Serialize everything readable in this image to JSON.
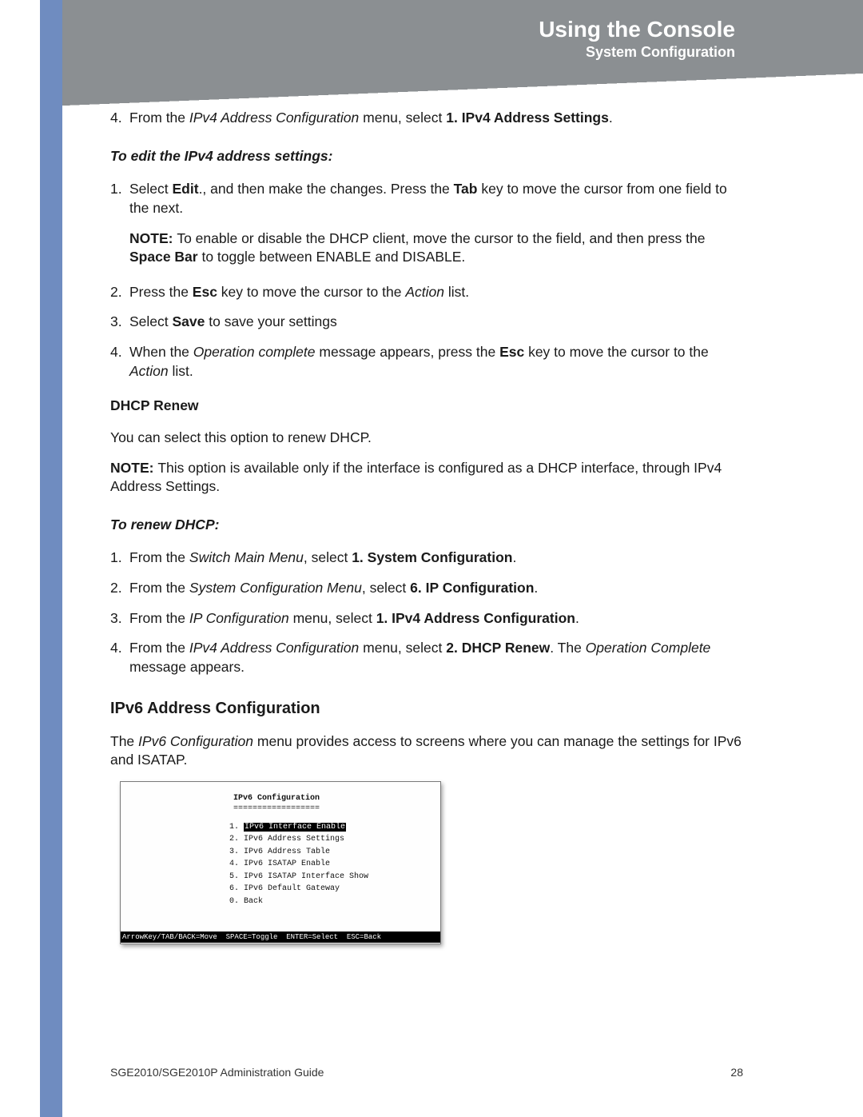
{
  "header": {
    "title": "Using the Console",
    "subtitle": "System Configuration"
  },
  "step4_top": {
    "num": "4.",
    "pre": "From the ",
    "ital": "IPv4 Address Configuration",
    "mid": " menu, select ",
    "bold": "1. IPv4 Address Settings",
    "post": "."
  },
  "edit_ipv4_heading": "To edit the IPv4 address settings:",
  "edit_steps": {
    "s1": {
      "num": "1.",
      "a": "Select ",
      "b": "Edit",
      "c": "., and then make the changes. Press the ",
      "d": "Tab",
      "e": " key to move the cursor from one field to the next."
    },
    "note1": {
      "label": "NOTE: ",
      "a": "To enable or disable the DHCP client, move the cursor to the field, and then press the ",
      "b": "Space Bar",
      "c": " to toggle between ENABLE and DISABLE."
    },
    "s2": {
      "num": "2.",
      "a": "Press the ",
      "b": "Esc",
      "c": " key to move the cursor to the ",
      "d": "Action",
      "e": " list."
    },
    "s3": {
      "num": "3.",
      "a": "Select ",
      "b": "Save",
      "c": " to save your settings"
    },
    "s4": {
      "num": "4.",
      "a": "When the ",
      "b": "Operation complete",
      "c": " message appears, press the ",
      "d": "Esc",
      "e": " key to move the cursor to the ",
      "f": "Action",
      "g": " list."
    }
  },
  "dhcp_renew_heading": "DHCP Renew",
  "dhcp_renew_intro": "You can select this option to renew DHCP.",
  "dhcp_note": {
    "label": "NOTE: ",
    "text": "This option is available only if the interface is configured as a DHCP interface, through IPv4 Address Settings."
  },
  "renew_heading": "To renew DHCP:",
  "renew_steps": {
    "s1": {
      "num": "1.",
      "a": "From the ",
      "b": "Switch Main Menu",
      "c": ", select ",
      "d": "1. System Configuration",
      "e": "."
    },
    "s2": {
      "num": "2.",
      "a": "From the ",
      "b": "System Configuration Menu",
      "c": ", select ",
      "d": "6. IP Configuration",
      "e": "."
    },
    "s3": {
      "num": "3.",
      "a": "From the ",
      "b": "IP Configuration",
      "c": " menu, select ",
      "d": "1. IPv4 Address Configuration",
      "e": "."
    },
    "s4": {
      "num": "4.",
      "a": "From the ",
      "b": "IPv4 Address Configuration",
      "c": " menu, select ",
      "d": "2. DHCP Renew",
      "e": ". The ",
      "f": "Operation Complete",
      "g": " message appears."
    }
  },
  "ipv6_heading": "IPv6 Address Configuration",
  "ipv6_intro": {
    "a": "The ",
    "b": "IPv6 Configuration",
    "c": " menu provides access to screens where you can manage the settings for IPv6 and ISATAP."
  },
  "console": {
    "title": "IPv6 Configuration",
    "rule": "==================",
    "items": [
      {
        "n": "1.",
        "label": "IPv6 Interface Enable",
        "selected": true
      },
      {
        "n": "2.",
        "label": "IPv6 Address Settings",
        "selected": false
      },
      {
        "n": "3.",
        "label": "IPv6 Address Table",
        "selected": false
      },
      {
        "n": "4.",
        "label": "IPv6 ISATAP Enable",
        "selected": false
      },
      {
        "n": "5.",
        "label": "IPv6 ISATAP Interface Show",
        "selected": false
      },
      {
        "n": "6.",
        "label": "IPv6 Default Gateway",
        "selected": false
      },
      {
        "n": "0.",
        "label": "Back",
        "selected": false
      }
    ],
    "footer": "ArrowKey/TAB/BACK=Move  SPACE=Toggle  ENTER=Select  ESC=Back"
  },
  "footer": {
    "guide": "SGE2010/SGE2010P Administration Guide",
    "page": "28"
  }
}
